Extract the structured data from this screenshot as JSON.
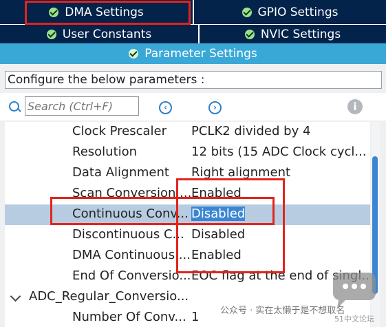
{
  "tabs": {
    "row1": [
      {
        "label": "DMA Settings"
      },
      {
        "label": "GPIO Settings"
      }
    ],
    "row2": [
      {
        "label": "User Constants"
      },
      {
        "label": "NVIC Settings"
      }
    ],
    "active": {
      "label": "Parameter Settings"
    }
  },
  "panel": {
    "description": "Configure the below parameters :",
    "search_placeholder": "Search (Ctrl+F)"
  },
  "params": [
    {
      "name": "Clock Prescaler",
      "value": "PCLK2 divided by 4"
    },
    {
      "name": "Resolution",
      "value": "12 bits (15 ADC Clock cycl..."
    },
    {
      "name": "Data Alignment",
      "value": "Right alignment"
    },
    {
      "name": "Scan Conversion ...",
      "value": "Enabled"
    },
    {
      "name": "Continuous Conv...",
      "value": "Disabled"
    },
    {
      "name": "Discontinuous C...",
      "value": "Disabled"
    },
    {
      "name": "DMA Continuous ...",
      "value": "Enabled"
    },
    {
      "name": "End Of Conversio...",
      "value": "EOC flag at the end of singl..."
    }
  ],
  "group": {
    "label": "ADC_Regular_Conversio..."
  },
  "group_params": [
    {
      "name": "Number Of Conv...",
      "value": "1"
    }
  ],
  "watermark": {
    "text": "公众号 · 实在太懒于是不想取名",
    "site": "51中文论坛"
  },
  "colors": {
    "tab_bg": "#03234b",
    "active_tab": "#3aa8d7",
    "selection": "#b7cce0",
    "highlight": "#e3231c"
  }
}
